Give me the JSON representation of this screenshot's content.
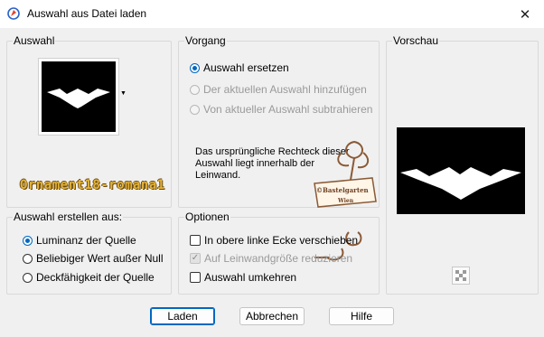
{
  "window": {
    "title": "Auswahl aus Datei laden"
  },
  "groups": {
    "auswahl": {
      "label": "Auswahl"
    },
    "vorgang": {
      "label": "Vorgang",
      "options": [
        {
          "label": "Auswahl ersetzen",
          "checked": true,
          "enabled": true
        },
        {
          "label": "Der aktuellen Auswahl hinzufügen",
          "checked": false,
          "enabled": false
        },
        {
          "label": "Von aktueller Auswahl subtrahieren",
          "checked": false,
          "enabled": false
        }
      ],
      "info": "Das ursprüngliche Rechteck dieser Auswahl liegt innerhalb der Leinwand."
    },
    "vorschau": {
      "label": "Vorschau"
    },
    "erstellen": {
      "label": "Auswahl erstellen aus:",
      "options": [
        {
          "label": "Luminanz der Quelle",
          "checked": true
        },
        {
          "label": "Beliebiger Wert außer Null",
          "checked": false
        },
        {
          "label": "Deckfähigkeit der Quelle",
          "checked": false
        }
      ]
    },
    "optionen": {
      "label": "Optionen",
      "checks": [
        {
          "label": "In obere linke Ecke verschieben",
          "checked": false,
          "enabled": true
        },
        {
          "label": "Auf Leinwandgröße reduzieren",
          "checked": true,
          "enabled": false
        },
        {
          "label": "Auswahl umkehren",
          "checked": false,
          "enabled": true
        }
      ]
    }
  },
  "buttons": {
    "laden": "Laden",
    "abbrechen": "Abbrechen",
    "hilfe": "Hilfe"
  },
  "watermark": {
    "text": "Ornament18-romana1",
    "stamp_line1": "©Bastelgarten",
    "stamp_line2": "Wien"
  },
  "colors": {
    "accent": "#0067c0",
    "dialog_bg": "#f0f0f0",
    "watermark_gold": "#e3b33a",
    "stamp_brown": "#8a5a36"
  }
}
